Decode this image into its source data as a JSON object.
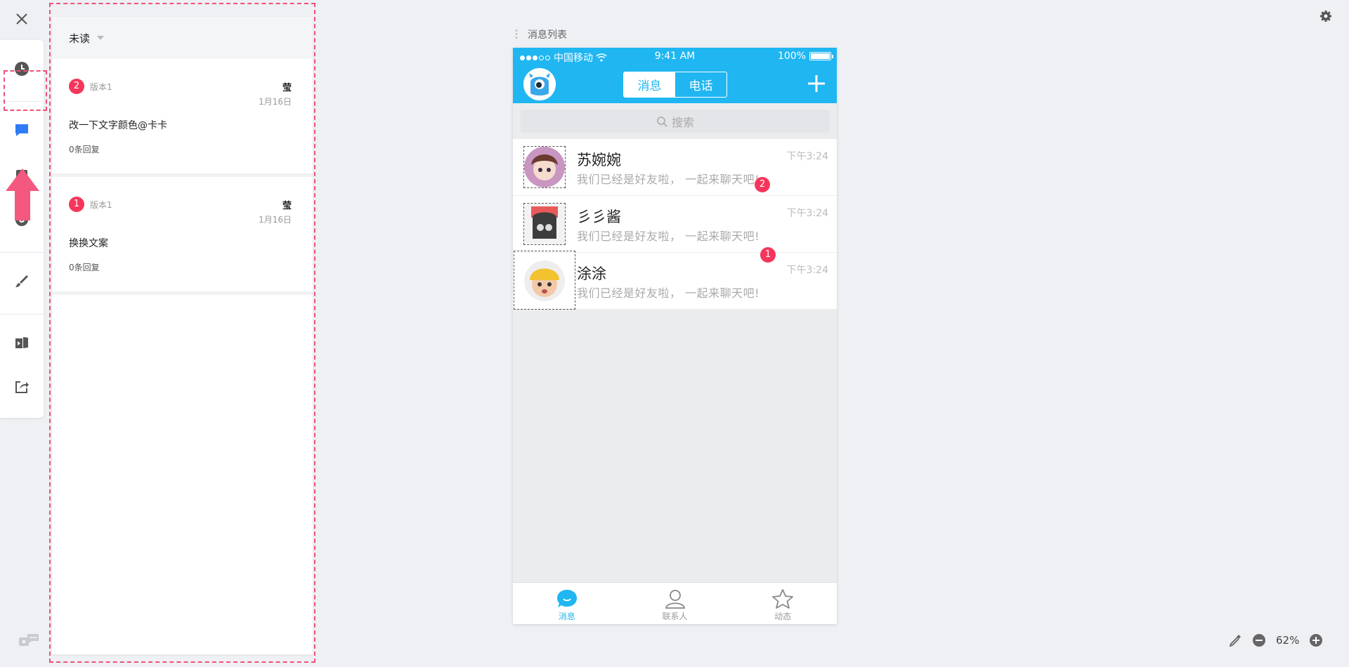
{
  "panel": {
    "filter_label": "未读",
    "comments": [
      {
        "badge": "2",
        "version": "版本1",
        "author": "莹",
        "date": "1月16日",
        "text": "改一下文字颜色@卡卡",
        "replies": "0条回复"
      },
      {
        "badge": "1",
        "version": "版本1",
        "author": "莹",
        "date": "1月16日",
        "text": "换换文案",
        "replies": "0条回复"
      }
    ]
  },
  "artboard": {
    "label": "消息列表"
  },
  "phone": {
    "status": {
      "carrier": "中国移动",
      "time": "9:41 AM",
      "battery": "100%"
    },
    "nav": {
      "tab_messages": "消息",
      "tab_calls": "电话"
    },
    "search_placeholder": "搜索",
    "contacts": [
      {
        "name": "苏婉婉",
        "message": "我们已经是好友啦， 一起来聊天吧!",
        "time": "下午3:24"
      },
      {
        "name": "彡彡酱",
        "message": "我们已经是好友啦， 一起来聊天吧!",
        "time": "下午3:24"
      },
      {
        "name": "涂涂",
        "message": "我们已经是好友啦， 一起来聊天吧!",
        "time": "下午3:24"
      }
    ],
    "pin_badges": [
      "2",
      "1"
    ],
    "tabbar": [
      "消息",
      "联系人",
      "动态"
    ]
  },
  "zoom": {
    "level": "62%"
  },
  "colors": {
    "accent": "#1fb6f2",
    "badge": "#f5365c",
    "annotation": "#f0507a",
    "active_icon": "#2f7cf6"
  },
  "icons": [
    "close-icon",
    "clock-icon",
    "comment-icon",
    "eye-icon",
    "brush-icon",
    "pages-icon",
    "share-icon",
    "settings-icon",
    "eyedropper-icon",
    "zoom-out-icon",
    "zoom-in-icon",
    "search-icon",
    "plus-icon"
  ]
}
